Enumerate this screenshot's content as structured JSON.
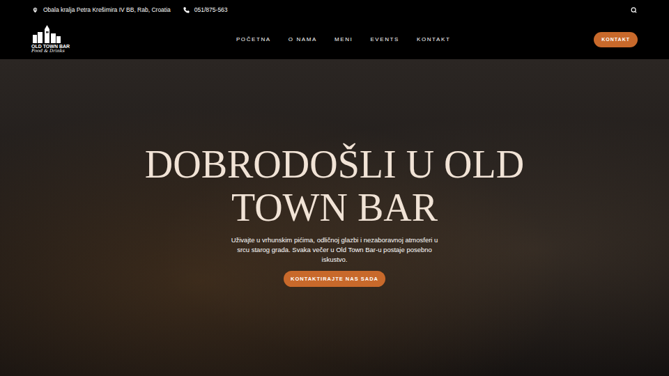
{
  "topbar": {
    "address": "Obala kralja Petra Krešimira IV BB, Rab, Croatia",
    "phone": "051/875-563"
  },
  "logo": {
    "name": "OLD TOWN BAR",
    "tagline": "Food & Drinks"
  },
  "nav": [
    {
      "label": "POČETNA",
      "selected": false
    },
    {
      "label": "O NAMA",
      "selected": false
    },
    {
      "label": "MENI",
      "selected": false
    },
    {
      "label": "EVENTS",
      "selected": false
    },
    {
      "label": "KONTAKT",
      "selected": false
    }
  ],
  "nav_button": "KONTAKT",
  "hero": {
    "title": "DOBRODOŠLI U OLD TOWN BAR",
    "text": "Uživajte u vrhunskim pićima, odličnoj glazbi i nezaboravnoj atmosferi u srcu starog grada. Svaka večer u Old Town Bar-u postaje posebno iskustvo.",
    "button": "KONTAKTIRAJTE NAS SADA"
  }
}
